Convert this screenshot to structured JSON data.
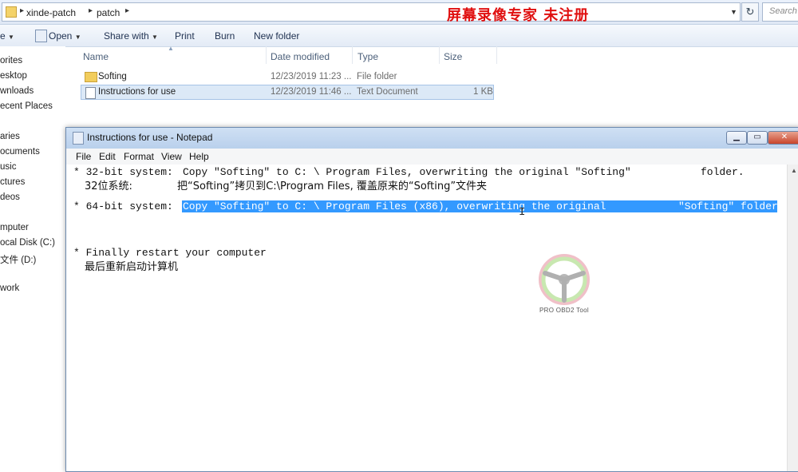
{
  "explorer": {
    "breadcrumb": [
      "xinde-patch",
      "patch"
    ],
    "watermark": "屏幕录像专家  未注册",
    "search_placeholder": "Search",
    "toolbar": {
      "organize_partial": "e",
      "open": "Open",
      "share_with": "Share with",
      "print": "Print",
      "burn": "Burn",
      "new_folder": "New folder"
    },
    "nav_items": [
      {
        "label": "orites"
      },
      {
        "label": "esktop"
      },
      {
        "label": "wnloads"
      },
      {
        "label": "ecent Places"
      },
      {
        "label": "aries"
      },
      {
        "label": "ocuments"
      },
      {
        "label": "usic"
      },
      {
        "label": "ctures"
      },
      {
        "label": "deos"
      },
      {
        "label": "mputer"
      },
      {
        "label": "ocal Disk (C:)"
      },
      {
        "label": "文件 (D:)"
      },
      {
        "label": "work"
      }
    ],
    "columns": {
      "name": "Name",
      "date": "Date modified",
      "type": "Type",
      "size": "Size"
    },
    "files": [
      {
        "name": "Softing",
        "date": "12/23/2019 11:23 ...",
        "type": "File folder",
        "size": ""
      },
      {
        "name": "Instructions for use",
        "date": "12/23/2019 11:46 ...",
        "type": "Text Document",
        "size": "1 KB"
      }
    ]
  },
  "notepad": {
    "title": "Instructions for use - Notepad",
    "menu": [
      "File",
      "Edit",
      "Format",
      "View",
      "Help"
    ],
    "lines": {
      "l1_label": "* 32-bit system:",
      "l1_text": "Copy \"Softing\" to C: \\ Program Files, overwriting the original \"Softing\"",
      "l1_end": "folder.",
      "l2_label": "32位系统:",
      "l2_text": "把“Softing”拷贝到C:\\Program Files, 覆盖原来的“Softing”文件夹",
      "l3_label": "* 64-bit system:",
      "l3_text": "Copy \"Softing\" to C: \\ Program Files (x86), overwriting the original",
      "l3_end": "\"Softing\" folder.",
      "l4": "* Finally restart your computer",
      "l5": "最后重新启动计算机"
    }
  },
  "logo": {
    "text": "PRO OBD2 Tool"
  },
  "colors": {
    "selection": "#3399ff",
    "watermark": "#e01010",
    "highlight_row": "#dce9f7"
  }
}
